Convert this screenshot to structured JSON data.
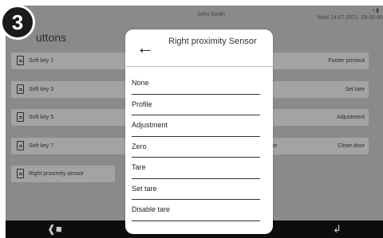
{
  "step_badge": "3",
  "status": {
    "user": "John Smith",
    "date": "Wed 14.07.2021",
    "time": "09:30:00",
    "signal_icon": "wifi-icon"
  },
  "page": {
    "title": "Buttons",
    "title_visible": "uttons"
  },
  "buttons_left": [
    {
      "label": "Soft key 1"
    },
    {
      "label": "Soft key 3"
    },
    {
      "label": "Soft key 5"
    },
    {
      "label": "Soft key 7"
    },
    {
      "label": "Right proximity sensor"
    }
  ],
  "buttons_right": [
    {
      "label": "Footer printout"
    },
    {
      "label": "Set tare"
    },
    {
      "label": "Adjustment"
    },
    {
      "label": "Close door"
    }
  ],
  "partial_label": "nsor",
  "dialog": {
    "back_icon": "arrow-left-icon",
    "title": "Right proximity Sensor",
    "options": [
      "None",
      "Profile",
      "Adjustment",
      "Zero",
      "Tare",
      "Set tare",
      "Disable tare"
    ]
  },
  "bottom_bar": {
    "icons": [
      "home-icon",
      "zero-icon",
      "tare-icon",
      "enter-icon"
    ]
  }
}
